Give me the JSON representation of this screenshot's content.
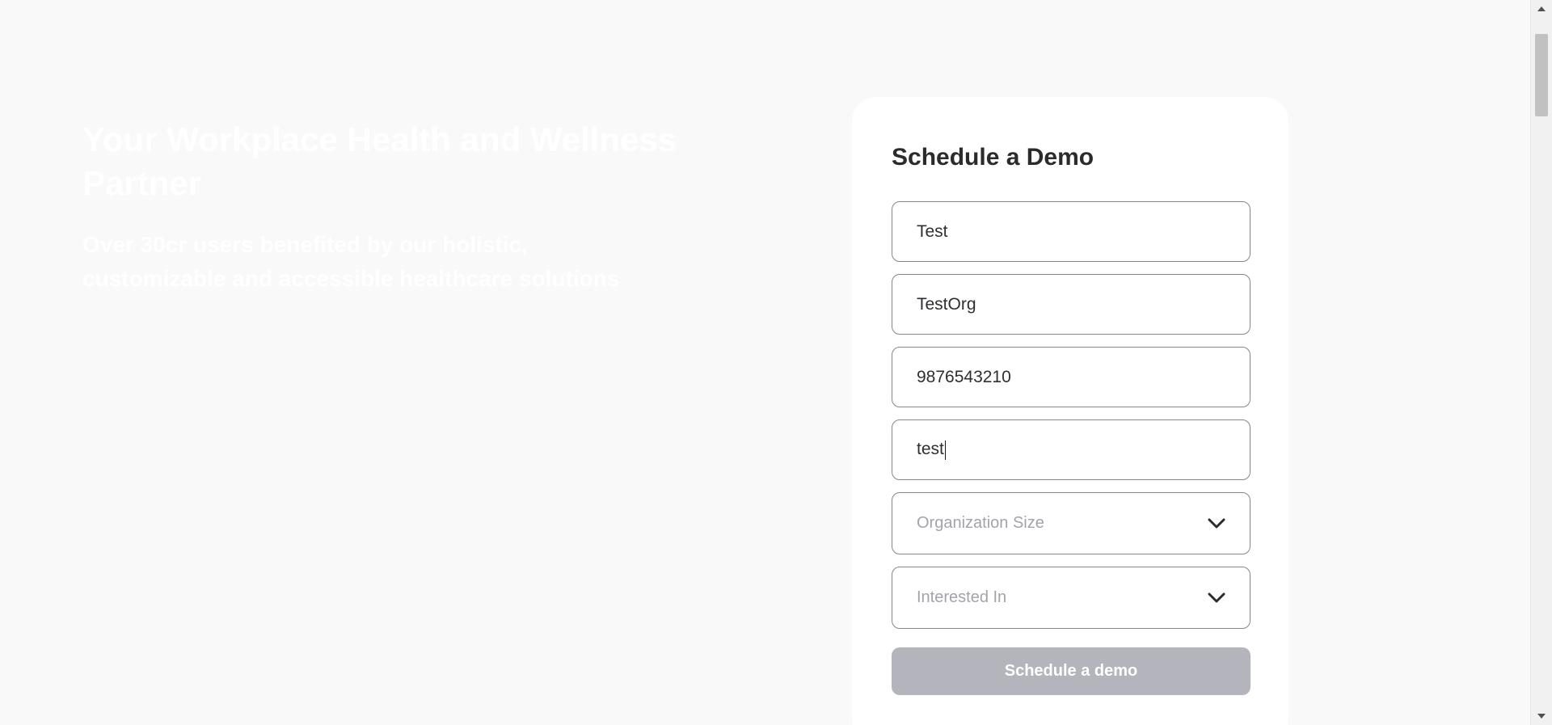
{
  "hero": {
    "title": "Your Workplace Health and Wellness Partner",
    "subtitle": "Over 30cr users benefited by our holistic, customizable and accessible healthcare solutions"
  },
  "form": {
    "title": "Schedule a Demo",
    "fields": [
      {
        "value": "Test"
      },
      {
        "value": "TestOrg"
      },
      {
        "value": "9876543210"
      },
      {
        "value": "test"
      }
    ],
    "selects": [
      {
        "placeholder": "Organization Size"
      },
      {
        "placeholder": "Interested In"
      }
    ],
    "submit_label": "Schedule a demo"
  },
  "icons": {
    "select_chevron": "chevron-down-icon",
    "scroll_up": "triangle-up-icon",
    "scroll_down": "triangle-down-icon"
  },
  "colors": {
    "background": "#f9f9f9",
    "card": "#ffffff",
    "border": "#86868c",
    "button_disabled": "#b4b4bc",
    "placeholder": "#a3a3aa",
    "heading": "#2b2b2e"
  }
}
